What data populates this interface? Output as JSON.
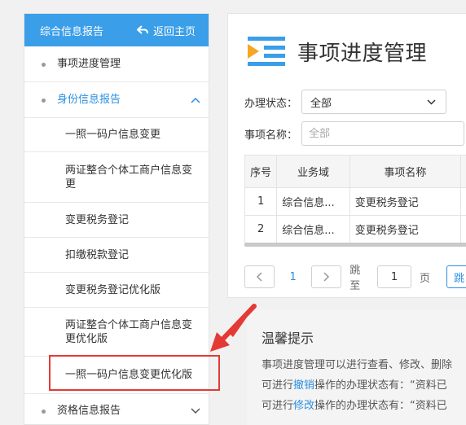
{
  "sidebar": {
    "title": "综合信息报告",
    "back": "返回主页",
    "items": [
      {
        "label": "事项进度管理"
      },
      {
        "label": "身份信息报告"
      },
      {
        "label": "一照一码户信息变更"
      },
      {
        "label": "两证整合个体工商户信息变更"
      },
      {
        "label": "变更税务登记"
      },
      {
        "label": "扣缴税款登记"
      },
      {
        "label": "变更税务登记优化版"
      },
      {
        "label": "两证整合个体工商户信息变更优化版"
      },
      {
        "label": "一照一码户信息变更优化版"
      },
      {
        "label": "资格信息报告"
      }
    ]
  },
  "main": {
    "title": "事项进度管理",
    "status_label": "办理状态：",
    "status_value": "全部",
    "name_label": "事项名称：",
    "name_placeholder": "全部",
    "table": {
      "headers": [
        "序号",
        "业务域",
        "事项名称"
      ],
      "rows": [
        [
          "1",
          "综合信息...",
          "变更税务登记"
        ],
        [
          "2",
          "综合信息...",
          "变更税务登记"
        ]
      ]
    },
    "pager": {
      "current": "1",
      "jump_label": "跳至",
      "page_input": "1",
      "page_unit": "页",
      "go": "跳"
    }
  },
  "tips": {
    "title": "温馨提示",
    "line1": "事项进度管理可以进行查看、修改、删除",
    "line2_pre": "可进行",
    "line2_link": "撤销",
    "line2_post": "操作的办理状态有：“资料已",
    "line3_pre": "可进行",
    "line3_link": "修改",
    "line3_post": "操作的办理状态有：“资料已"
  },
  "colors": {
    "header_blue": "#3a9ee8",
    "link_blue": "#2b8fe0",
    "highlight_red": "#e53935"
  }
}
